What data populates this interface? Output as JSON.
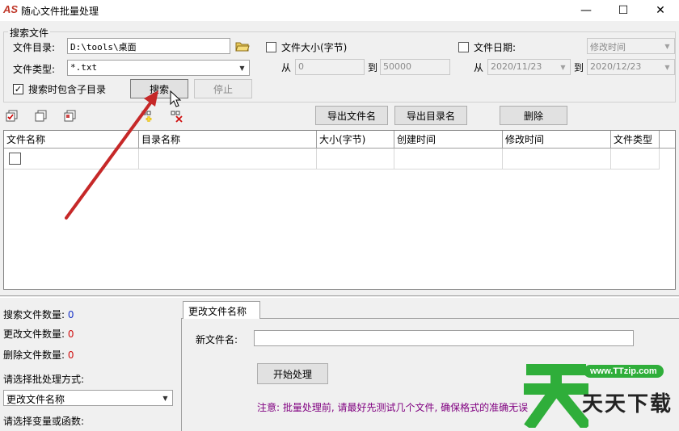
{
  "window": {
    "logo": "AS",
    "title": "随心文件批量处理",
    "minimize_glyph": "—",
    "maximize_glyph": "☐",
    "close_glyph": "✕"
  },
  "search_group": {
    "legend": "搜索文件",
    "dir_label": "文件目录:",
    "dir_value": "D:\\tools\\桌面",
    "type_label": "文件类型:",
    "type_value": "*.txt",
    "include_subdirs_label": "搜索时包含子目录",
    "include_subdirs_checked": true,
    "search_button": "搜索",
    "stop_button": "停止",
    "size_filter_label": "文件大小(字节)",
    "size_from_label": "从",
    "size_from_value": "0",
    "size_to_label": "到",
    "size_to_value": "50000",
    "date_filter_label": "文件日期:",
    "date_kind_value": "修改时间",
    "date_from_label": "从",
    "date_from_value": "2020/11/23",
    "date_to_label": "到",
    "date_to_value": "2020/12/23"
  },
  "toolbar": {
    "export_filenames": "导出文件名",
    "export_dirnames": "导出目录名",
    "delete": "删除"
  },
  "grid": {
    "columns": [
      "文件名称",
      "目录名称",
      "大小(字节)",
      "创建时间",
      "修改时间",
      "文件类型"
    ]
  },
  "stats": {
    "search_count_label": "搜索文件数量:",
    "search_count_value": "0",
    "changed_count_label": "更改文件数量:",
    "changed_count_value": "0",
    "deleted_count_label": "删除文件数量:",
    "deleted_count_value": "0",
    "mode_label": "请选择批处理方式:",
    "mode_value": "更改文件名称",
    "var_label": "请选择变量或函数:"
  },
  "rename_panel": {
    "tab_label": "更改文件名称",
    "new_name_label": "新文件名:",
    "new_name_value": "",
    "start_button": "开始处理",
    "note": "注意: 批量处理前, 请最好先测试几个文件, 确保格式的准确无误"
  },
  "watermark": {
    "url": "www.TTzip.com",
    "text": "天天下载"
  },
  "colors": {
    "arrow": "#c62828",
    "stat_blue": "#1a35c8",
    "stat_red": "#d01010",
    "note_purple": "#800080",
    "watermark_green": "#2fae3a"
  }
}
